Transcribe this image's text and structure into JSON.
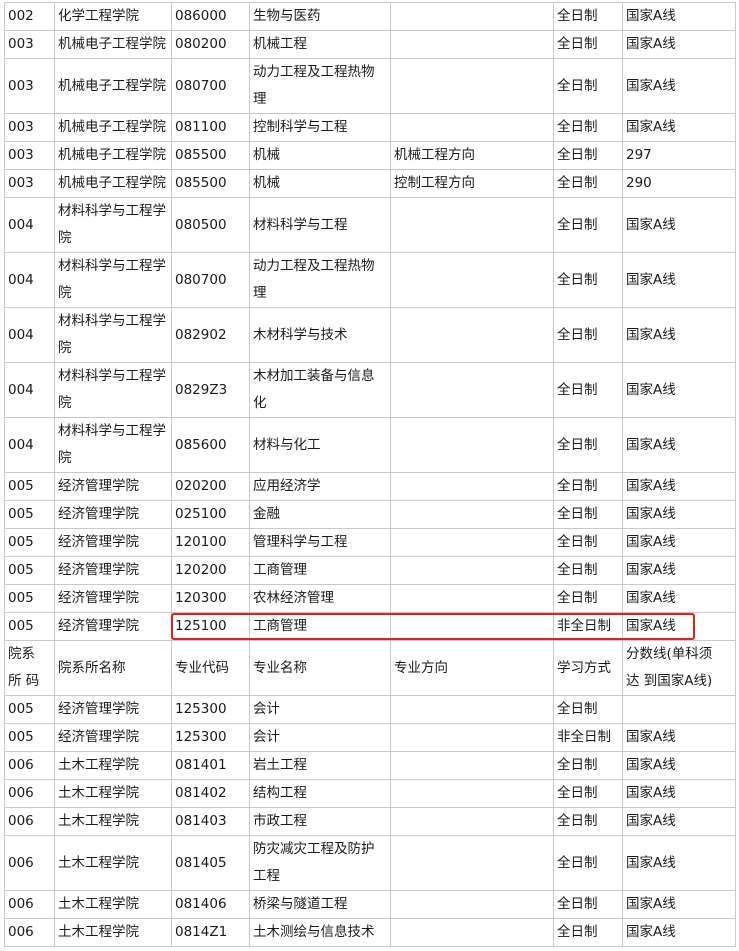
{
  "rows": [
    {
      "h": "h28",
      "c": [
        "002",
        "化学工程学院",
        "086000",
        "生物与医药",
        "",
        "全日制",
        "国家A线"
      ]
    },
    {
      "h": "h28",
      "c": [
        "003",
        "机械电子工程学院",
        "080200",
        "机械工程",
        "",
        "全日制",
        "国家A线"
      ]
    },
    {
      "h": "h56",
      "c": [
        "003",
        "机械电子工程学院",
        "080700",
        "动力工程及工程热物\n理",
        "",
        "全日制",
        "国家A线"
      ]
    },
    {
      "h": "h28",
      "c": [
        "003",
        "机械电子工程学院",
        "081100",
        "控制科学与工程",
        "",
        "全日制",
        "国家A线"
      ]
    },
    {
      "h": "h28",
      "c": [
        "003",
        "机械电子工程学院",
        "085500",
        "机械",
        "机械工程方向",
        "全日制",
        "297"
      ]
    },
    {
      "h": "h28",
      "c": [
        "003",
        "机械电子工程学院",
        "085500",
        "机械",
        "控制工程方向",
        "全日制",
        "290"
      ]
    },
    {
      "h": "h56",
      "c": [
        "004",
        "材料科学与工程学\n院",
        "080500",
        "材料科学与工程",
        "",
        "全日制",
        "国家A线"
      ]
    },
    {
      "h": "h56",
      "c": [
        "004",
        "材料科学与工程学\n院",
        "080700",
        "动力工程及工程热物\n理",
        "",
        "全日制",
        "国家A线"
      ]
    },
    {
      "h": "h56",
      "c": [
        "004",
        "材料科学与工程学\n院",
        "082902",
        "木材科学与技术",
        "",
        "全日制",
        "国家A线"
      ]
    },
    {
      "h": "h56",
      "c": [
        "004",
        "材料科学与工程学\n院",
        "0829Z3",
        "木材加工装备与信息\n化",
        "",
        "全日制",
        "国家A线"
      ]
    },
    {
      "h": "h56",
      "c": [
        "004",
        "材料科学与工程学\n院",
        "085600",
        "材料与化工",
        "",
        "全日制",
        "国家A线"
      ]
    },
    {
      "h": "h28",
      "c": [
        "005",
        "经济管理学院",
        "020200",
        "应用经济学",
        "",
        "全日制",
        "国家A线"
      ]
    },
    {
      "h": "h28",
      "c": [
        "005",
        "经济管理学院",
        "025100",
        "金融",
        "",
        "全日制",
        "国家A线"
      ]
    },
    {
      "h": "h28",
      "c": [
        "005",
        "经济管理学院",
        "120100",
        "管理科学与工程",
        "",
        "全日制",
        "国家A线"
      ]
    },
    {
      "h": "h28",
      "c": [
        "005",
        "经济管理学院",
        "120200",
        "工商管理",
        "",
        "全日制",
        "国家A线"
      ]
    },
    {
      "h": "h28",
      "c": [
        "005",
        "经济管理学院",
        "120300",
        "农林经济管理",
        "",
        "全日制",
        "国家A线"
      ]
    },
    {
      "h": "h28",
      "c": [
        "005",
        "经济管理学院",
        "125100",
        "工商管理",
        "",
        "非全日制",
        "国家A线"
      ]
    },
    {
      "h": "h52",
      "c": [
        "院系\n所 码",
        "院系所名称",
        "专业代码",
        "专业名称",
        "专业方向",
        "学习方式",
        "分数线(单科须\n达 到国家A线)"
      ]
    },
    {
      "h": "h28",
      "c": [
        "005",
        "经济管理学院",
        "125300",
        "会计",
        "",
        "全日制",
        ""
      ]
    },
    {
      "h": "h28",
      "c": [
        "005",
        "经济管理学院",
        "125300",
        "会计",
        "",
        "非全日制",
        "国家A线"
      ]
    },
    {
      "h": "h28",
      "c": [
        "006",
        "土木工程学院",
        "081401",
        "岩土工程",
        "",
        "全日制",
        "国家A线"
      ]
    },
    {
      "h": "h28",
      "c": [
        "006",
        "土木工程学院",
        "081402",
        "结构工程",
        "",
        "全日制",
        "国家A线"
      ]
    },
    {
      "h": "h28",
      "c": [
        "006",
        "土木工程学院",
        "081403",
        "市政工程",
        "",
        "全日制",
        "国家A线"
      ]
    },
    {
      "h": "h56",
      "c": [
        "006",
        "土木工程学院",
        "081405",
        "防灾减灾工程及防护\n工程",
        "",
        "全日制",
        "国家A线"
      ]
    },
    {
      "h": "h28",
      "c": [
        "006",
        "土木工程学院",
        "081406",
        "桥梁与隧道工程",
        "",
        "全日制",
        "国家A线"
      ]
    },
    {
      "h": "h28",
      "c": [
        "006",
        "土木工程学院",
        "0814Z1",
        "土木测绘与信息技术",
        "",
        "全日制",
        "国家A线"
      ]
    }
  ]
}
